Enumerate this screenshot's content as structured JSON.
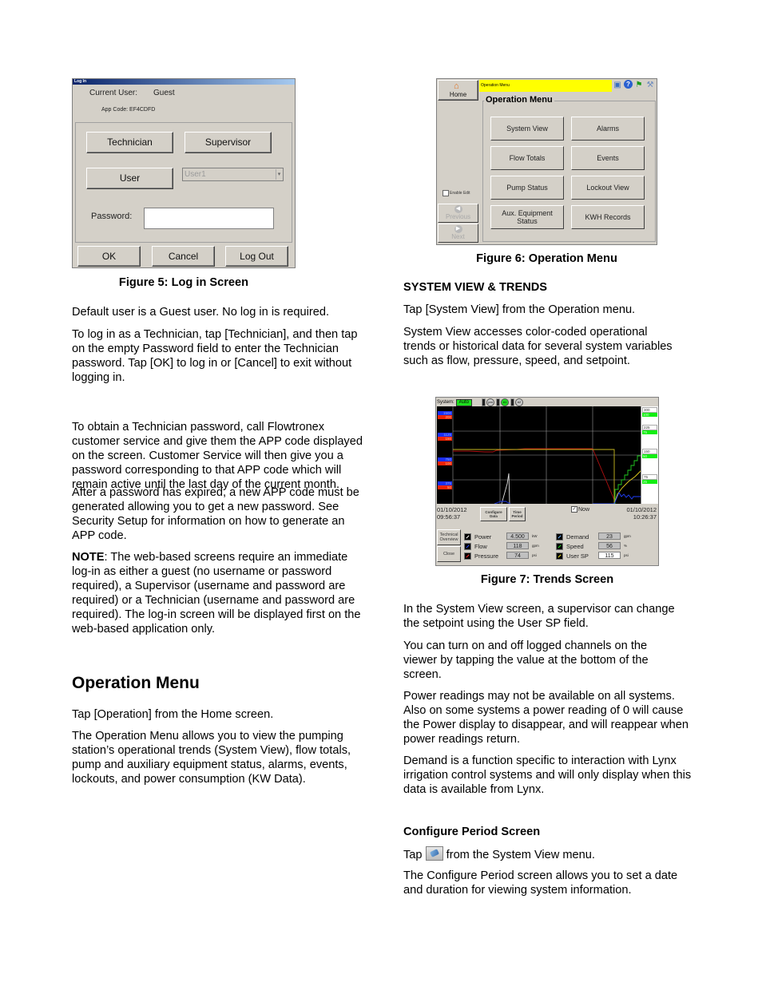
{
  "login_window": {
    "title": "Log In",
    "current_user_label": "Current User:",
    "current_user_value": "Guest",
    "app_code": "App Code: EF4CDFD",
    "buttons": {
      "technician": "Technician",
      "supervisor": "Supervisor",
      "user": "User",
      "ok": "OK",
      "cancel": "Cancel",
      "log_out": "Log Out"
    },
    "user_select_value": "User1",
    "password_label": "Password:",
    "password_value": ""
  },
  "figure5_caption": "Figure 5: Log in Screen",
  "left_column": {
    "paragraphs": [
      "Default user is a Guest user. No log in is required.",
      "To log in as a Technician, tap [Technician], and then tap on the empty Password field to enter the Technician password. Tap [OK] to log in or [Cancel] to exit without logging in.",
      "To obtain a Technician password, call Flowtronex customer service and give them the APP code displayed on the screen. Customer Service will then give you a password corresponding to that APP code which will remain active until the last day of the current month.",
      "After a password has expired, a new APP code must be generated allowing you to get a new password. See Security Setup for information on how to generate an APP code."
    ],
    "note_label": "NOTE",
    "note_text": ": The web-based screens require an immediate log-in as either a guest (no username or password required), a Supervisor (username and password are required) or a Technician (username and password are required). The log-in screen will be displayed first on the web-based application only.",
    "operation_heading": "Operation Menu",
    "operation_paragraphs": [
      "Tap [Operation] from the Home screen.",
      "The Operation Menu allows you to view the pumping station’s operational trends (System View), flow totals, pump and auxiliary equipment status, alarms, events, lockouts, and power consumption (KW Data)."
    ]
  },
  "operation_window": {
    "title_bar": "Operation Menu",
    "home_label": "Home",
    "group_title": "Operation Menu",
    "buttons": [
      "System View",
      "Alarms",
      "Flow Totals",
      "Events",
      "Pump Status",
      "Lockout View",
      "Aux. Equipment Status",
      "KWH Records"
    ],
    "enable_edit_label": "Enable Edit",
    "previous_label": "Previous",
    "next_label": "Next",
    "icons": [
      "network-icon",
      "help-icon",
      "flag-icon",
      "tools-icon"
    ]
  },
  "figure6_caption": "Figure 6: Operation Menu",
  "right_column": {
    "system_view_heading": "SYSTEM VIEW & TRENDS",
    "system_view_paragraphs": [
      "Tap [System View] from the Operation menu.",
      "System View accesses color-coded operational trends or historical data for several system variables such as flow, pressure, speed, and setpoint."
    ],
    "after_fig7_paragraphs": [
      "In the System View screen, a supervisor can change the setpoint using the User SP field.",
      "You can turn on and off logged channels on the viewer by tapping the value at the bottom of the screen.",
      "Power readings may not be available on all systems. Also on some systems a power reading of 0 will cause the Power display to disappear, and will reappear when power readings return.",
      "Demand is a function specific to interaction with Lynx irrigation control systems and will only display when this data is available from Lynx."
    ],
    "configure_heading": "Configure Period Screen",
    "configure_tap_before": "Tap",
    "configure_tap_after": "from the System View menu.",
    "configure_paragraph": "The Configure Period screen allows you to set a date and duration for viewing system information."
  },
  "trends_window": {
    "system_label": "System:",
    "system_mode": "Auto",
    "pumps": [
      "pm",
      "#1",
      "#2"
    ],
    "left_axis_tags": [
      {
        "blue": "1500",
        "red": "200"
      },
      {
        "blue": "1125",
        "red": "150"
      },
      {
        "blue": "750",
        "red": "100"
      },
      {
        "blue": "375",
        "red": "50"
      }
    ],
    "right_axis_tags": [
      {
        "white": "300",
        "green": "100"
      },
      {
        "white": "225",
        "green": "75"
      },
      {
        "white": "150",
        "green": "50"
      },
      {
        "white": "75",
        "green": "25"
      }
    ],
    "start_date": "01/10/2012",
    "start_time": "09:56:37",
    "end_date": "01/10/2012",
    "end_time": "10:26:37",
    "configure_data_label": "Configure Data",
    "time_period_label": "Time Period",
    "now_label": "Now",
    "now_checked": true,
    "technical_overview_label": "Technical Overview",
    "close_label": "Close",
    "channels_left": [
      {
        "name": "Power",
        "value": "4.500",
        "unit": "kW",
        "color": "#ffffff"
      },
      {
        "name": "Flow",
        "value": "118",
        "unit": "gpm",
        "color": "#2a4dff"
      },
      {
        "name": "Pressure",
        "value": "74",
        "unit": "psi",
        "color": "#ff2a2a"
      }
    ],
    "channels_right": [
      {
        "name": "Demand",
        "value": "23",
        "unit": "gpm",
        "color": "#6fb6ff"
      },
      {
        "name": "Speed",
        "value": "56",
        "unit": "%",
        "color": "#22dd22"
      },
      {
        "name": "User SP",
        "value": "115",
        "unit": "psi",
        "color": "#e8e020"
      }
    ]
  },
  "figure7_caption": "Figure 7: Trends Screen"
}
